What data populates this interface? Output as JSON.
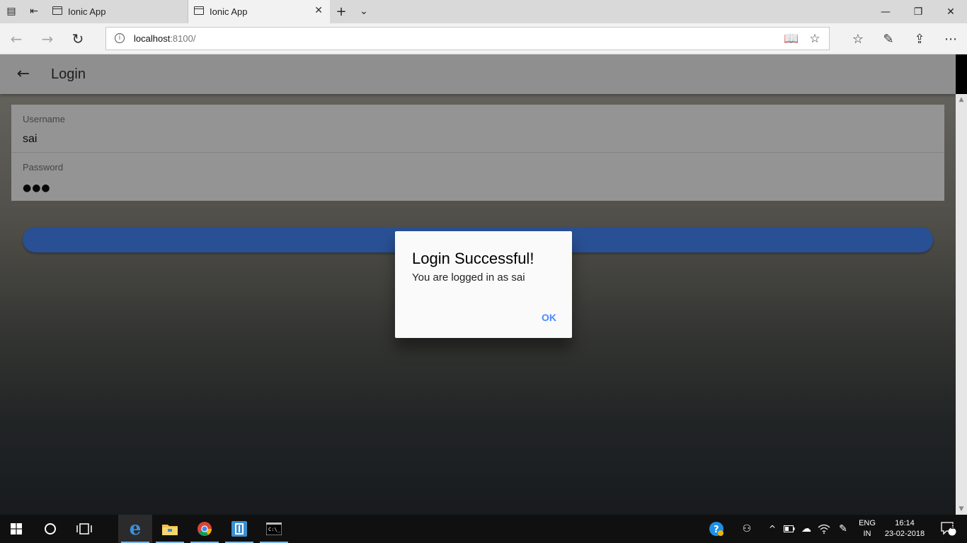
{
  "browser": {
    "tabs": [
      {
        "title": "Ionic App",
        "active": false
      },
      {
        "title": "Ionic App",
        "active": true
      }
    ],
    "address": {
      "host": "localhost",
      "port": ":8100/"
    }
  },
  "app": {
    "header_title": "Login",
    "username_label": "Username",
    "username_value": "sai",
    "password_label": "Password",
    "password_masked": "●●●",
    "accent_color": "#488aff"
  },
  "alert": {
    "title": "Login Successful!",
    "message": "You are logged in as sai",
    "ok_label": "OK"
  },
  "taskbar": {
    "lang_top": "ENG",
    "lang_bottom": "IN",
    "time": "16:14",
    "date": "23-02-2018",
    "notification_count": "2"
  }
}
